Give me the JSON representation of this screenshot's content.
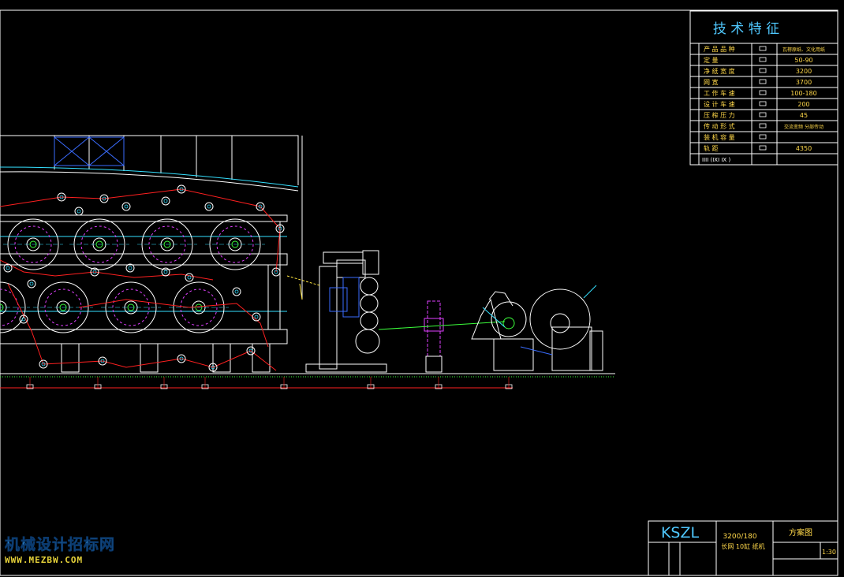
{
  "tech_table": {
    "title": "技 术 特 征",
    "rows": [
      {
        "label": "产 品 品 种",
        "value": "瓦楞原纸、文化用纸"
      },
      {
        "label": "定 量",
        "value": "50-90"
      },
      {
        "label": "净 纸 宽 度",
        "value": "3200"
      },
      {
        "label": "网 宽",
        "value": "3700"
      },
      {
        "label": "工 作 车 速",
        "value": "100-180"
      },
      {
        "label": "设 计 车 速",
        "value": "200"
      },
      {
        "label": "压 榨 压 力",
        "value": "45"
      },
      {
        "label": "传 动 形 式",
        "value": "交流变频 分部传动"
      },
      {
        "label": "装 机 容 量",
        "value": ""
      },
      {
        "label": "轨 距",
        "value": "4350"
      }
    ],
    "last_row": "IIII (IXI IX )"
  },
  "title_block": {
    "company": "KSZL",
    "model": "3200/180",
    "subtitle": "长网 10缸 纸机",
    "drawing_name": "方案图",
    "scale": "1:30"
  },
  "watermark": {
    "name": "机械设计招标网",
    "url": "WWW.MEZBW.COM"
  },
  "colors": {
    "frame": "#ffffff",
    "table_title": "#4fc8ff",
    "table_text": "#ffd84a",
    "machine": "#ffffff",
    "felt": "#ff2020",
    "cyan": "#35e0ff",
    "magenta": "#e040ff",
    "green": "#3cff3c",
    "blue": "#3a6cff",
    "yellow": "#ffe640"
  }
}
